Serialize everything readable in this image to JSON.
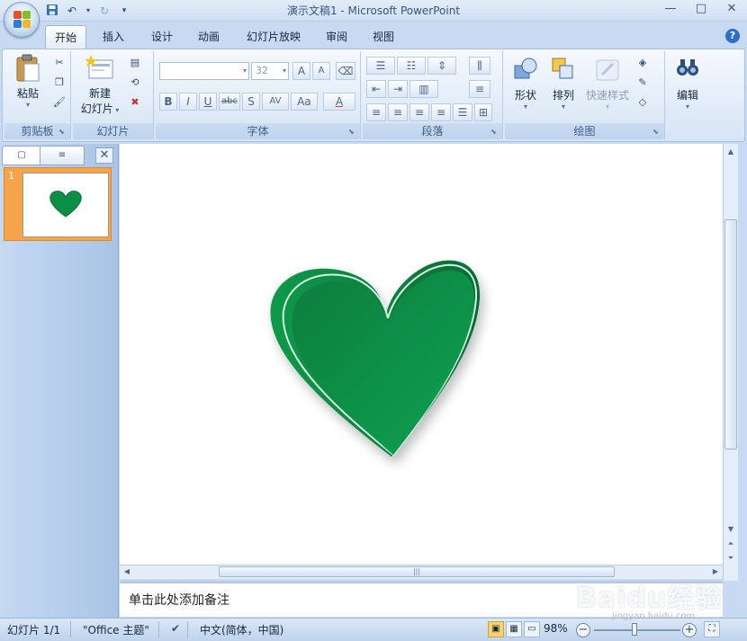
{
  "app": {
    "title": "演示文稿1 - Microsoft PowerPoint",
    "accent": "#2d6ec8"
  },
  "quick_access": {
    "items": [
      "save-icon",
      "undo-icon",
      "redo-icon",
      "customize-icon"
    ],
    "redo_symbol": "↻",
    "undo_symbol": "↶"
  },
  "window_controls": {
    "minimize": "—",
    "maximize": "□",
    "close": "✕"
  },
  "ribbon": {
    "tabs": [
      {
        "label": "开始",
        "active": true
      },
      {
        "label": "插入"
      },
      {
        "label": "设计"
      },
      {
        "label": "动画"
      },
      {
        "label": "幻灯片放映"
      },
      {
        "label": "审阅"
      },
      {
        "label": "视图"
      }
    ],
    "help": "?",
    "groups": {
      "clipboard": {
        "label": "剪贴板",
        "paste": "粘贴"
      },
      "slides": {
        "label": "幻灯片",
        "new_slide_line1": "新建",
        "new_slide_line2": "幻灯片"
      },
      "font": {
        "label": "字体",
        "font_name": "",
        "font_size": "32",
        "grow": "A",
        "shrink": "A",
        "bold": "B",
        "italic": "I",
        "underline": "U",
        "strike": "abc",
        "shadow": "S",
        "spacing": "AV",
        "case": "Aa",
        "color": "A"
      },
      "paragraph": {
        "label": "段落"
      },
      "drawing": {
        "label": "绘图",
        "shapes": "形状",
        "arrange": "排列",
        "quick_styles": "快速样式"
      },
      "editing": {
        "label": "编辑"
      }
    }
  },
  "slides_panel": {
    "tab_slides": "▢",
    "tab_outline": "≡",
    "close": "✕",
    "thumbnails": [
      {
        "number": "1"
      }
    ]
  },
  "slide": {
    "shape": "heart",
    "fill_color": "#0a8f45",
    "edge_color": "#06703a"
  },
  "notes": {
    "placeholder": "单击此处添加备注"
  },
  "status": {
    "slide": "幻灯片 1/1",
    "theme": "\"Office 主题\"",
    "language": "中文(简体，中国)",
    "zoom": "98%",
    "zoom_minus": "−",
    "zoom_plus": "+"
  },
  "watermark": {
    "brand": "Baidu经验",
    "url": "jingyan.baidu.com"
  }
}
